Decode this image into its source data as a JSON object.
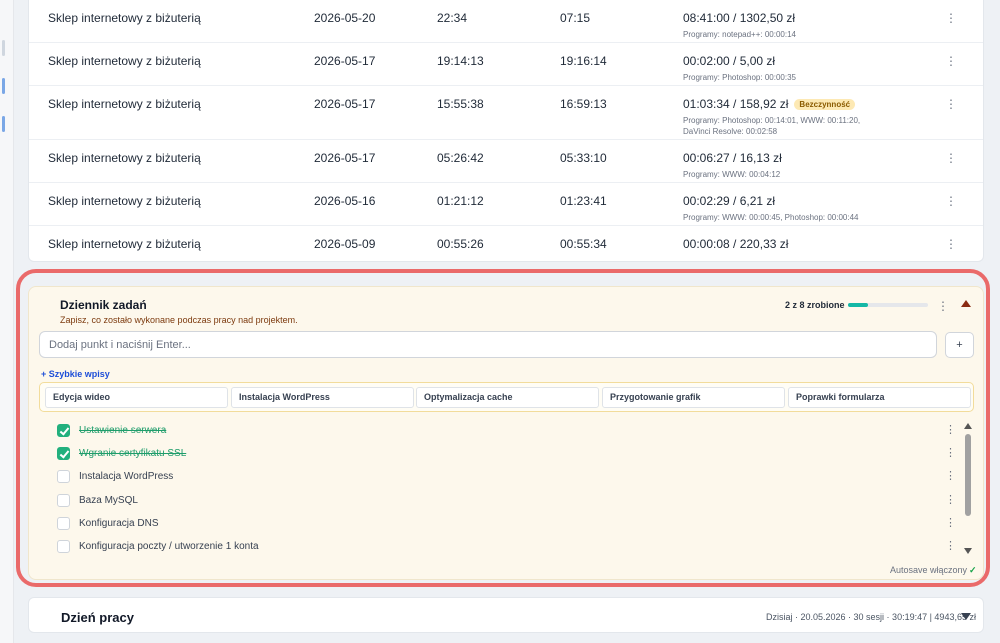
{
  "sessions": [
    {
      "project": "Sklep internetowy z biżuterią",
      "date": "2026-05-20",
      "start": "22:34",
      "end": "07:15",
      "duration": "08:41:00 / 1302,50 zł",
      "badge": "",
      "programs": "Programy: notepad++: 00:00:14"
    },
    {
      "project": "Sklep internetowy z biżuterią",
      "date": "2026-05-17",
      "start": "19:14:13",
      "end": "19:16:14",
      "duration": "00:02:00 / 5,00 zł",
      "badge": "",
      "programs": "Programy: Photoshop: 00:00:35"
    },
    {
      "project": "Sklep internetowy z biżuterią",
      "date": "2026-05-17",
      "start": "15:55:38",
      "end": "16:59:13",
      "duration": "01:03:34 / 158,92 zł",
      "badge": "Bezczynność",
      "programs": "Programy: Photoshop: 00:14:01, WWW: 00:11:20, DaVinci Resolve: 00:02:58"
    },
    {
      "project": "Sklep internetowy z biżuterią",
      "date": "2026-05-17",
      "start": "05:26:42",
      "end": "05:33:10",
      "duration": "00:06:27 / 16,13 zł",
      "badge": "",
      "programs": "Programy: WWW: 00:04:12"
    },
    {
      "project": "Sklep internetowy z biżuterią",
      "date": "2026-05-16",
      "start": "01:21:12",
      "end": "01:23:41",
      "duration": "00:02:29 / 6,21 zł",
      "badge": "",
      "programs": "Programy: WWW: 00:00:45, Photoshop: 00:00:44"
    },
    {
      "project": "Sklep internetowy z biżuterią",
      "date": "2026-05-09",
      "start": "00:55:26",
      "end": "00:55:34",
      "duration": "00:00:08 / 220,33 zł",
      "badge": "",
      "programs": ""
    }
  ],
  "row_menu_icon": "⋮",
  "journal": {
    "title": "Dziennik zadań",
    "subtitle": "Zapisz, co zostało wykonane podczas pracy nad projektem.",
    "progress_text": "2 z 8 zrobione",
    "progress_fraction": 0.25,
    "progress_color": "#14b8a6",
    "input_placeholder": "Dodaj punkt i naciśnij Enter...",
    "add_button": "+",
    "quick_link": "+ Szybkie wpisy",
    "quick_entries": [
      "Edycja wideo",
      "Instalacja WordPress",
      "Optymalizacja cache",
      "Przygotowanie grafik",
      "Poprawki formularza"
    ],
    "tasks": [
      {
        "label": "Ustawienie serwera",
        "done": true
      },
      {
        "label": "Wgranie certyfikatu SSL",
        "done": true
      },
      {
        "label": "Instalacja WordPress",
        "done": false
      },
      {
        "label": "Baza MySQL",
        "done": false
      },
      {
        "label": "Konfiguracja DNS",
        "done": false
      },
      {
        "label": "Konfiguracja poczty / utworzenie 1 konta",
        "done": false
      }
    ],
    "autosave": "Autosave włączony",
    "autosave_check": "✓"
  },
  "workday": {
    "title": "Dzień pracy",
    "summary": "Dzisiaj · 20.05.2026 · 30 sesji · 30:19:47 | 4943,65 zł"
  },
  "colors": {
    "highlight": "#ea6a6a",
    "accent": "#1d4ed8",
    "done": "#22b07d"
  }
}
